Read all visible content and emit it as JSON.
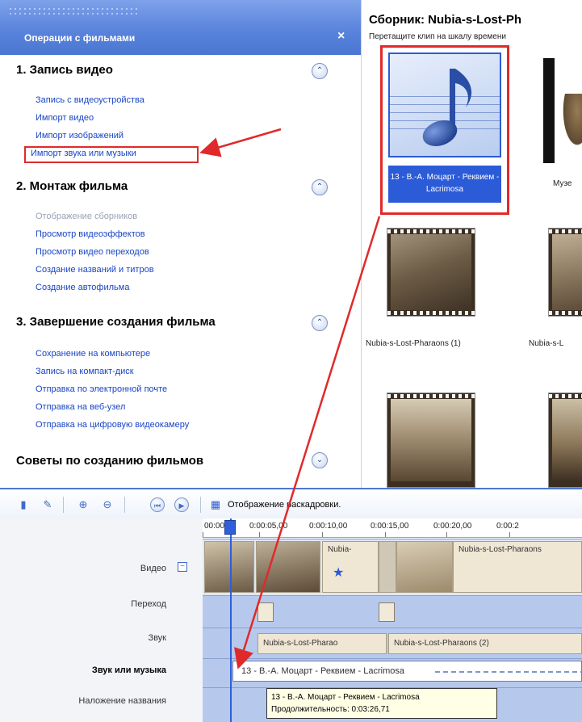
{
  "task_pane": {
    "title": "Операции с фильмами",
    "close": "×",
    "sections": [
      {
        "heading": "1. Запись видео",
        "toggle": "⌃",
        "links": [
          "Запись с видеоустройства",
          "Импорт видео",
          "Импорт изображений",
          "Импорт звука или музыки"
        ]
      },
      {
        "heading": "2. Монтаж фильма",
        "toggle": "⌃",
        "links": [
          "Отображение сборников",
          "Просмотр видеоэффектов",
          "Просмотр видео переходов",
          "Создание названий и титров",
          "Создание автофильма"
        ]
      },
      {
        "heading": "3. Завершение создания фильма",
        "toggle": "⌃",
        "links": [
          "Сохранение на компьютере",
          "Запись на компакт-диск",
          "Отправка по электронной почте",
          "Отправка на веб-узел",
          "Отправка на цифровую видеокамеру"
        ]
      },
      {
        "heading": "Советы по созданию фильмов",
        "toggle": "⌄",
        "links": []
      }
    ]
  },
  "collection": {
    "title": "Сборник: Nubia-s-Lost-Ph",
    "subtitle": "Перетащите клип на шкалу времени",
    "items": [
      {
        "caption": "13 - В.-А. Моцарт - Реквием - Lacrimosa",
        "selected": true,
        "icon": "music-note-icon"
      },
      {
        "caption": "Музе"
      },
      {
        "caption": "Nubia-s-Lost-Pharaons (1)"
      },
      {
        "caption": "Nubia-s-L"
      },
      {
        "caption": ""
      },
      {
        "caption": ""
      }
    ]
  },
  "timeline_toolbar": {
    "storyboard_label": "Отображение раскадровки."
  },
  "timeline": {
    "ruler": [
      "00:00",
      "0:00:05,00",
      "0:00:10,00",
      "0:00:15,00",
      "0:00:20,00",
      "0:00:2"
    ],
    "tracks": {
      "video": "Видео",
      "transition": "Переход",
      "audio": "Звук",
      "music": "Звук или музыка",
      "title_overlay": "Наложение названия"
    },
    "video_clips": [
      "Nubia-",
      "Nubia-s-Lost-Pharaons"
    ],
    "audio_clips": [
      "Nubia-s-Lost-Pharao",
      "Nubia-s-Lost-Pharaons (2)"
    ],
    "music_clip": "13 - В.-А. Моцарт - Реквием - Lacrimosa",
    "tooltip": {
      "title": "13 - В.-А. Моцарт - Реквием - Lacrimosa",
      "duration": "Продолжительность:  0:03:26,71"
    }
  },
  "colors": {
    "pane_header": "#5a84dc",
    "link": "#1845c7",
    "selection": "#2b5bd7",
    "annotation": "#e02a2a",
    "timeline_lane": "#b6c9ec"
  }
}
